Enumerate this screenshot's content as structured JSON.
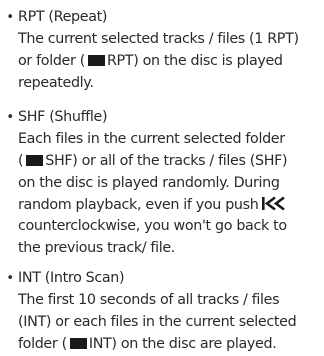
{
  "items": [
    {
      "bullet": "•",
      "lines": [
        [
          "RPT (Repeat)"
        ],
        [
          "The current selected tracks / files (1 RPT)"
        ],
        [
          "or folder (",
          "RPT) on the disc is played"
        ],
        [
          "repeatedly."
        ]
      ],
      "icons": {
        "folder_line": 2
      }
    },
    {
      "bullet": "•",
      "lines": [
        [
          "SHF (Shuffle)"
        ],
        [
          "Each files in the current selected folder"
        ],
        [
          "(",
          "SHF) or all of the tracks / files (SHF)"
        ],
        [
          "on the disc is played randomly. During"
        ],
        [
          "random playback, even if you push",
          ""
        ],
        [
          "counterclockwise, you won't go back to"
        ],
        [
          "the previous track/ file."
        ]
      ],
      "icons": {
        "folder_line": 2,
        "prev_line": 4
      }
    },
    {
      "bullet": "•",
      "lines": [
        [
          "INT (Intro Scan)"
        ],
        [
          "The first 10 seconds of all tracks / files"
        ],
        [
          "(INT) or each files in the current selected"
        ],
        [
          "folder (",
          "INT) on the disc are played."
        ]
      ],
      "icons": {
        "folder_line": 3
      }
    }
  ],
  "icon_names": {
    "folder": "folder-icon",
    "prev": "skip-previous-icon"
  },
  "colors": {
    "text": "#2a2a2a",
    "icon": "#1a1a1a"
  }
}
